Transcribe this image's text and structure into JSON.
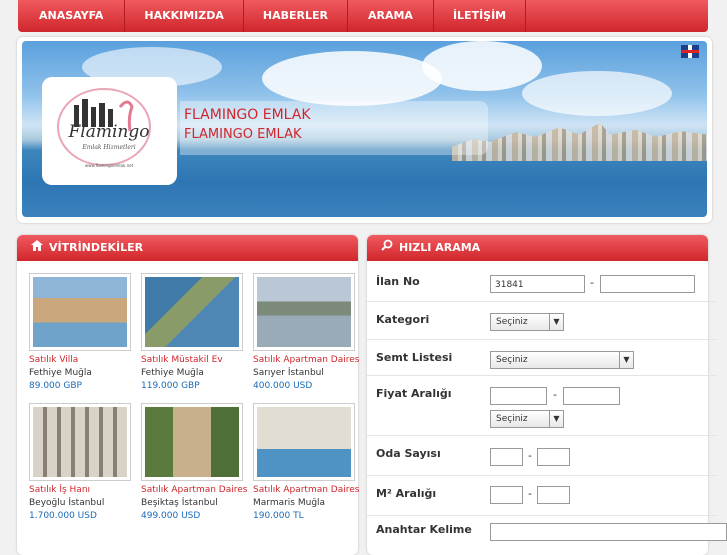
{
  "nav": [
    "ANASAYFA",
    "HAKKIMIZDA",
    "HABERLER",
    "ARAMA",
    "İLETİŞİM"
  ],
  "hero": {
    "title1": "FLAMINGO EMLAK",
    "title2": "FLAMINGO EMLAK",
    "logo_text": "Flamingo",
    "logo_sub": "Emlak Hizmetleri",
    "logo_url": "www.flamingoemlak.net"
  },
  "showcase": {
    "title": "VİTRİNDEKİLER",
    "items": [
      {
        "type": "Satılık Villa",
        "loc": "Fethiye Muğla",
        "price": "89.000 GBP"
      },
      {
        "type": "Satılık Müstakil Ev",
        "loc": "Fethiye Muğla",
        "price": "119.000 GBP"
      },
      {
        "type": "Satılık Apartman Daires",
        "loc": "Sarıyer İstanbul",
        "price": "400.000 USD"
      },
      {
        "type": "Satılık İş Hanı",
        "loc": "Beyoğlu İstanbul",
        "price": "1.700.000 USD"
      },
      {
        "type": "Satılık Apartman Daires",
        "loc": "Beşiktaş İstanbul",
        "price": "499.000 USD"
      },
      {
        "type": "Satılık Apartman Daires",
        "loc": "Marmaris Muğla",
        "price": "190.000 TL"
      }
    ]
  },
  "search": {
    "title": "HIZLI ARAMA",
    "ilan_label": "İlan No",
    "ilan_value": "31841",
    "dash": "-",
    "kategori_label": "Kategori",
    "kategori_value": "Seçiniz",
    "semt_label": "Semt Listesi",
    "semt_value": "Seçiniz",
    "fiyat_label": "Fiyat Aralığı",
    "fiyat_currency": "Seçiniz",
    "oda_label": "Oda Sayısı",
    "m2_label": "M² Aralığı",
    "anahtar_label": "Anahtar Kelime"
  }
}
